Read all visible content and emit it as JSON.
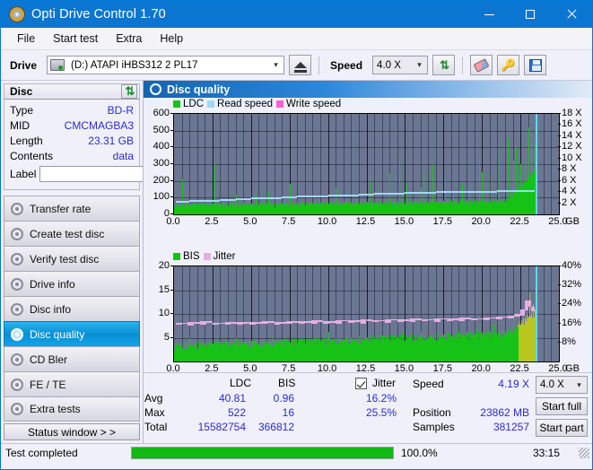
{
  "window": {
    "title": "Opti Drive Control 1.70",
    "icon": "disc-icon",
    "minimize": "—",
    "maximize": "□",
    "close": "✕"
  },
  "menu": {
    "items": [
      "File",
      "Start test",
      "Extra",
      "Help"
    ]
  },
  "toolbar": {
    "drive_label": "Drive",
    "drive_value": "(D:)   ATAPI iHBS312   2 PL17",
    "eject_icon": "eject-icon",
    "speed_label": "Speed",
    "speed_value": "4.0 X",
    "refresh_icon": "refresh-icon",
    "erase_icon": "eraser-icon",
    "keys_icon": "keys-icon",
    "save_icon": "save-icon"
  },
  "disc": {
    "panel_title": "Disc",
    "refresh_icon": "refresh-icon",
    "rows": [
      {
        "key": "Type",
        "value": "BD-R"
      },
      {
        "key": "MID",
        "value": "CMCMAGBA3"
      },
      {
        "key": "Length",
        "value": "23.31 GB"
      },
      {
        "key": "Contents",
        "value": "data"
      }
    ],
    "label_key": "Label",
    "label_value": "",
    "label_placeholder": "",
    "label_icon": "cd-icon"
  },
  "nav": {
    "items": [
      {
        "label": "Transfer rate",
        "active": false
      },
      {
        "label": "Create test disc",
        "active": false
      },
      {
        "label": "Verify test disc",
        "active": false
      },
      {
        "label": "Drive info",
        "active": false
      },
      {
        "label": "Disc info",
        "active": false
      },
      {
        "label": "Disc quality",
        "active": true
      },
      {
        "label": "CD Bler",
        "active": false
      },
      {
        "label": "FE / TE",
        "active": false
      },
      {
        "label": "Extra tests",
        "active": false
      }
    ],
    "status_window": "Status window > >"
  },
  "content_header": {
    "title": "Disc quality",
    "icon": "disc-quality-icon"
  },
  "stats": {
    "col_ldc": "LDC",
    "col_bis": "BIS",
    "row_avg": "Avg",
    "row_max": "Max",
    "row_total": "Total",
    "ldc_avg": "40.81",
    "ldc_max": "522",
    "ldc_total": "15582754",
    "bis_avg": "0.96",
    "bis_max": "16",
    "bis_total": "366812",
    "jitter_label": "Jitter",
    "jitter_checked": true,
    "jitter_avg": "16.2%",
    "jitter_max": "25.5%",
    "speed_label": "Speed",
    "speed_value": "4.19 X",
    "position_label": "Position",
    "position_value": "23862 MB",
    "samples_label": "Samples",
    "samples_value": "381257",
    "speed_select": "4.0 X",
    "start_full": "Start full",
    "start_part": "Start part"
  },
  "statusbar": {
    "message": "Test completed",
    "progress_text": "100.0%",
    "progress_percent": 100,
    "elapsed": "33:15"
  },
  "colors": {
    "accent": "#0b76d1",
    "ldc": "#16c216",
    "read_speed": "#9fd8f2",
    "write_speed": "#ff5fd0",
    "bis": "#16c216",
    "jitter": "#e3aee0",
    "plot_bg": "#6b7693",
    "progress": "#13b913"
  },
  "chart_data": [
    {
      "type": "bar",
      "id": "ldc-chart",
      "title": "",
      "legend": [
        {
          "label": "LDC",
          "color": "#16c216"
        },
        {
          "label": "Read speed",
          "color": "#9fd8f2"
        },
        {
          "label": "Write speed",
          "color": "#ff5fd0"
        }
      ],
      "legend_position": "top-left",
      "grid": true,
      "xlabel": "GB",
      "xlim": [
        0,
        25
      ],
      "xticks": [
        "0.0",
        "2.5",
        "5.0",
        "7.5",
        "10.0",
        "12.5",
        "15.0",
        "17.5",
        "20.0",
        "22.5",
        "25.0"
      ],
      "ylabel": "",
      "ylim": [
        0,
        600
      ],
      "yticks": [
        0,
        100,
        200,
        300,
        400,
        500,
        600
      ],
      "y2label": "",
      "y2lim": [
        0,
        18
      ],
      "y2ticks": [
        "2 X",
        "4 X",
        "6 X",
        "8 X",
        "10 X",
        "12 X",
        "14 X",
        "16 X",
        "18 X"
      ],
      "cursor_x": 23.5,
      "series": [
        {
          "name": "LDC",
          "color": "#16c216",
          "x": [
            0.1,
            0.3,
            0.5,
            0.8,
            1.0,
            1.3,
            1.5,
            1.8,
            2.0,
            2.3,
            2.6,
            2.9,
            3.1,
            3.4,
            3.7,
            4.0,
            4.2,
            4.5,
            4.8,
            5.0,
            5.3,
            5.6,
            5.9,
            6.1,
            6.4,
            6.7,
            7.0,
            7.2,
            7.5,
            7.8,
            8.0,
            8.3,
            8.6,
            8.9,
            9.1,
            9.4,
            9.7,
            10.0,
            10.2,
            10.5,
            10.8,
            11.0,
            11.3,
            11.6,
            11.9,
            12.1,
            12.4,
            12.7,
            13.0,
            13.2,
            13.5,
            13.8,
            14.0,
            14.3,
            14.6,
            14.9,
            15.1,
            15.4,
            15.7,
            16.0,
            16.2,
            16.5,
            16.8,
            17.0,
            17.3,
            17.6,
            17.9,
            18.1,
            18.4,
            18.7,
            19.0,
            19.2,
            19.5,
            19.8,
            20.0,
            20.3,
            20.6,
            20.9,
            21.1,
            21.4,
            21.7,
            22.0,
            22.2,
            22.5,
            22.8,
            23.0,
            23.2,
            23.4
          ],
          "values": [
            55,
            60,
            210,
            70,
            58,
            62,
            65,
            70,
            62,
            58,
            300,
            72,
            64,
            60,
            66,
            120,
            62,
            70,
            60,
            64,
            120,
            68,
            70,
            140,
            64,
            66,
            62,
            70,
            180,
            66,
            62,
            70,
            64,
            68,
            62,
            66,
            70,
            62,
            64,
            160,
            66,
            62,
            68,
            64,
            70,
            66,
            62,
            200,
            70,
            64,
            66,
            62,
            240,
            70,
            330,
            64,
            180,
            66,
            62,
            160,
            250,
            66,
            300,
            70,
            64,
            200,
            66,
            130,
            70,
            180,
            64,
            200,
            66,
            330,
            250,
            62,
            200,
            66,
            380,
            64,
            460,
            320,
            400,
            300,
            350,
            520,
            480,
            430
          ]
        },
        {
          "name": "Read speed",
          "color": "#9fd8f2",
          "x": [
            0.1,
            1.0,
            2.0,
            3.0,
            4.0,
            5.0,
            6.0,
            7.0,
            8.0,
            9.0,
            10.0,
            11.0,
            12.0,
            13.0,
            14.0,
            15.0,
            16.0,
            17.0,
            18.0,
            19.0,
            20.0,
            21.0,
            22.0,
            23.0,
            23.4
          ],
          "values": [
            2.4,
            2.5,
            2.6,
            2.8,
            2.9,
            3.0,
            3.1,
            3.2,
            3.3,
            3.4,
            3.5,
            3.6,
            3.7,
            3.8,
            3.9,
            4.0,
            4.05,
            4.1,
            4.15,
            4.2,
            4.25,
            4.3,
            4.35,
            4.4,
            4.4
          ],
          "axis": "y2"
        },
        {
          "name": "Write speed",
          "color": "#ff5fd0",
          "x": [],
          "values": [],
          "axis": "y2"
        }
      ]
    },
    {
      "type": "bar",
      "id": "bis-jitter-chart",
      "title": "",
      "legend": [
        {
          "label": "BIS",
          "color": "#16c216"
        },
        {
          "label": "Jitter",
          "color": "#e3aee0"
        }
      ],
      "legend_position": "top-left",
      "grid": true,
      "xlabel": "GB",
      "xlim": [
        0,
        25
      ],
      "xticks": [
        "0.0",
        "2.5",
        "5.0",
        "7.5",
        "10.0",
        "12.5",
        "15.0",
        "17.5",
        "20.0",
        "22.5",
        "25.0"
      ],
      "ylabel": "",
      "ylim": [
        0,
        20
      ],
      "yticks": [
        5,
        10,
        15,
        20
      ],
      "y2label": "",
      "y2lim": [
        0,
        40
      ],
      "y2ticks": [
        "8%",
        "16%",
        "24%",
        "32%",
        "40%"
      ],
      "cursor_x": 23.5,
      "series": [
        {
          "name": "BIS",
          "color": "#16c216",
          "x": [
            0.1,
            0.4,
            0.7,
            1.0,
            1.3,
            1.6,
            1.9,
            2.2,
            2.5,
            2.8,
            3.1,
            3.4,
            3.7,
            4.0,
            4.3,
            4.6,
            4.9,
            5.2,
            5.5,
            5.8,
            6.1,
            6.4,
            6.7,
            7.0,
            7.3,
            7.6,
            7.9,
            8.2,
            8.5,
            8.8,
            9.1,
            9.4,
            9.7,
            10.0,
            10.3,
            10.6,
            10.9,
            11.2,
            11.5,
            11.8,
            12.1,
            12.4,
            12.7,
            13.0,
            13.3,
            13.6,
            13.9,
            14.2,
            14.5,
            14.8,
            15.1,
            15.4,
            15.7,
            16.0,
            16.3,
            16.6,
            16.9,
            17.2,
            17.5,
            17.8,
            18.1,
            18.4,
            18.7,
            19.0,
            19.3,
            19.6,
            19.9,
            20.2,
            20.5,
            20.8,
            21.1,
            21.4,
            21.7,
            22.0,
            22.3,
            22.6,
            22.9,
            23.1,
            23.3,
            23.4
          ],
          "values": [
            3.5,
            4.2,
            3.0,
            5.0,
            3.4,
            4.6,
            3.2,
            4.0,
            3.8,
            5.2,
            3.4,
            4.4,
            3.0,
            5.0,
            3.6,
            4.2,
            3.2,
            4.8,
            3.4,
            4.0,
            3.6,
            5.4,
            3.2,
            4.6,
            3.8,
            4.2,
            3.4,
            5.0,
            3.6,
            4.4,
            3.2,
            4.8,
            3.4,
            6.2,
            3.8,
            4.6,
            3.4,
            5.0,
            3.6,
            4.2,
            3.8,
            5.6,
            3.4,
            4.8,
            3.6,
            5.2,
            3.8,
            4.4,
            4.0,
            6.0,
            4.2,
            5.0,
            4.4,
            6.2,
            4.6,
            5.4,
            4.8,
            6.6,
            5.0,
            5.8,
            5.2,
            7.0,
            5.4,
            6.2,
            5.6,
            7.4,
            5.8,
            6.6,
            6.2,
            8.0,
            6.4,
            7.2,
            6.8,
            9.0,
            7.4,
            8.2,
            10.0,
            14.5,
            12.0,
            11.0
          ]
        },
        {
          "name": "Jitter",
          "color": "#e3aee0",
          "axis": "y2",
          "x": [
            0.1,
            0.5,
            0.9,
            1.3,
            1.7,
            2.1,
            2.5,
            2.9,
            3.3,
            3.7,
            4.1,
            4.5,
            4.9,
            5.3,
            5.7,
            6.1,
            6.5,
            6.9,
            7.3,
            7.7,
            8.1,
            8.5,
            8.9,
            9.3,
            9.7,
            10.1,
            10.5,
            10.9,
            11.3,
            11.7,
            12.1,
            12.5,
            12.9,
            13.3,
            13.7,
            14.1,
            14.5,
            14.9,
            15.3,
            15.7,
            16.1,
            16.5,
            16.9,
            17.3,
            17.7,
            18.1,
            18.5,
            18.9,
            19.3,
            19.7,
            20.1,
            20.5,
            20.9,
            21.3,
            21.7,
            22.1,
            22.5,
            22.8,
            23.0,
            23.2,
            23.4
          ],
          "values": [
            16.0,
            16.4,
            15.8,
            16.6,
            16.0,
            16.8,
            16.2,
            16.4,
            15.9,
            16.5,
            16.1,
            16.7,
            16.0,
            16.6,
            16.3,
            16.8,
            16.2,
            16.6,
            16.4,
            17.0,
            16.3,
            16.8,
            16.5,
            17.2,
            16.6,
            17.0,
            16.4,
            17.4,
            16.8,
            17.2,
            16.6,
            17.6,
            17.0,
            17.4,
            16.9,
            17.8,
            17.2,
            17.6,
            17.0,
            18.0,
            17.4,
            17.8,
            17.2,
            18.2,
            17.6,
            18.0,
            17.5,
            18.4,
            17.8,
            18.2,
            18.0,
            18.6,
            18.2,
            19.0,
            18.6,
            19.4,
            20.0,
            22.0,
            25.5,
            23.0,
            21.0
          ]
        }
      ]
    }
  ]
}
